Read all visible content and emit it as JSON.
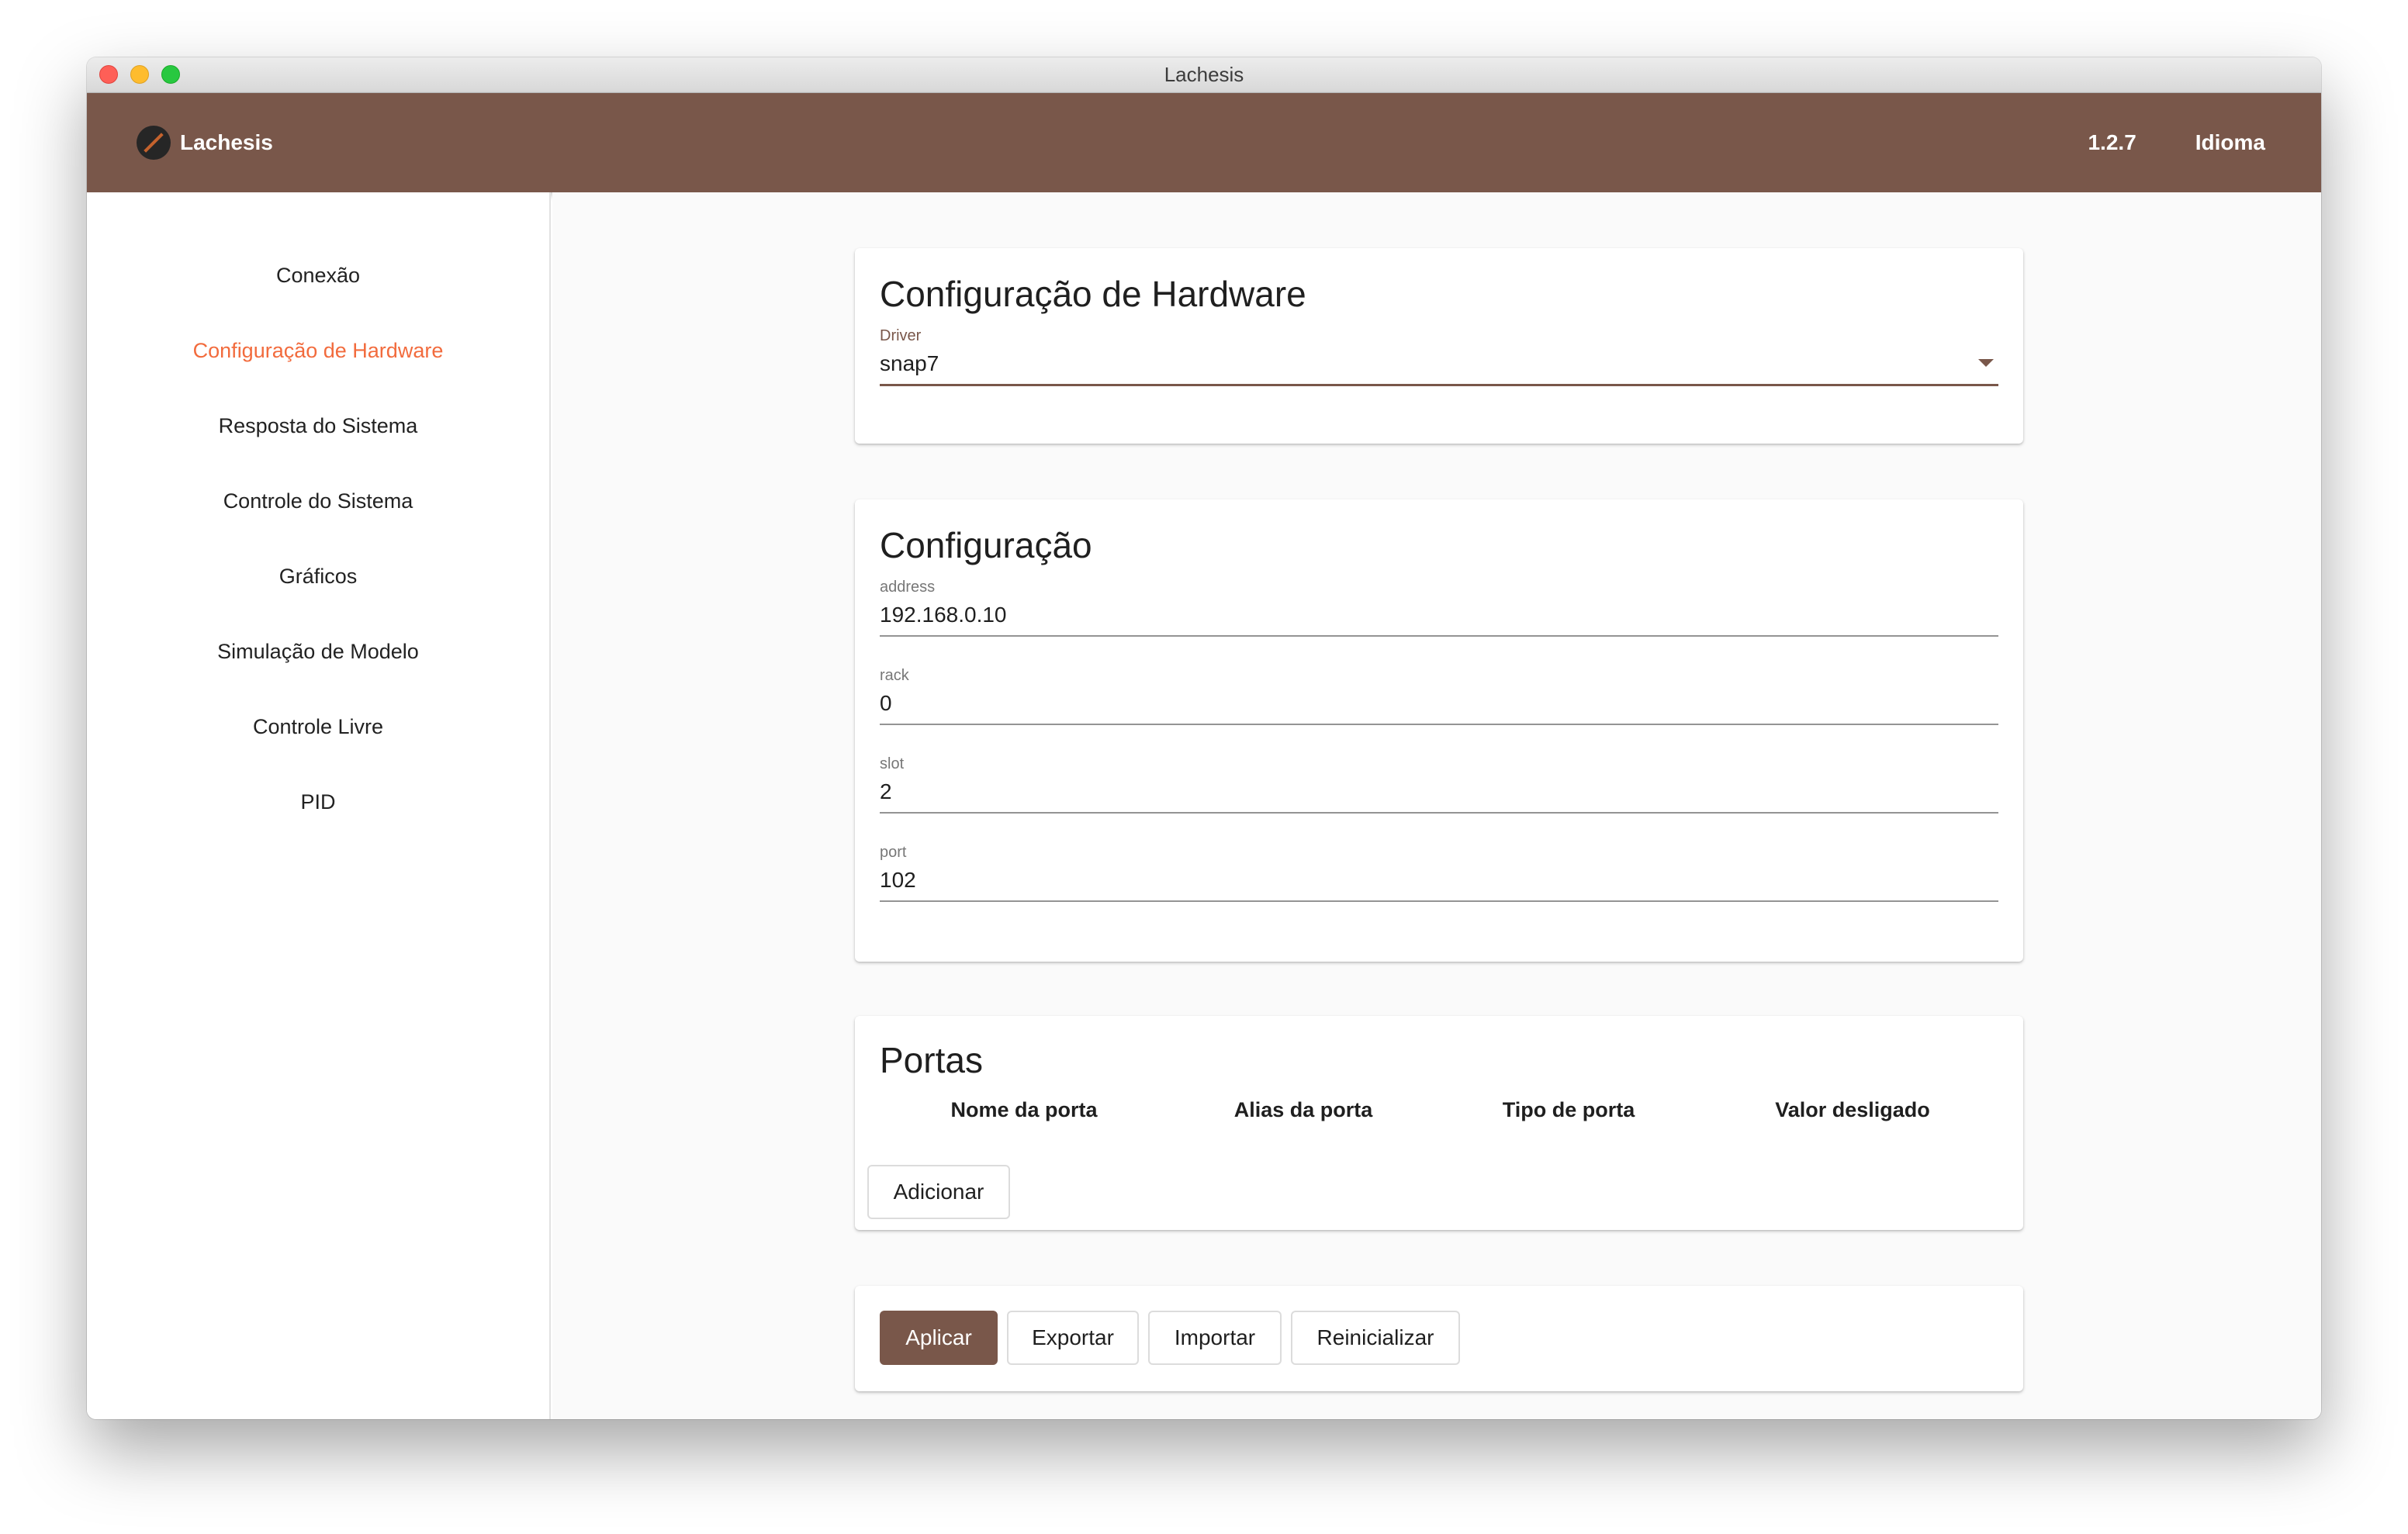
{
  "window": {
    "title": "Lachesis"
  },
  "appbar": {
    "app_name": "Lachesis",
    "version": "1.2.7",
    "language_button": "Idioma"
  },
  "sidebar": {
    "items": [
      {
        "label": "Conexão",
        "active": false
      },
      {
        "label": "Configuração de Hardware",
        "active": true
      },
      {
        "label": "Resposta do Sistema",
        "active": false
      },
      {
        "label": "Controle do Sistema",
        "active": false
      },
      {
        "label": "Gráficos",
        "active": false
      },
      {
        "label": "Simulação de Modelo",
        "active": false
      },
      {
        "label": "Controle Livre",
        "active": false
      },
      {
        "label": "PID",
        "active": false
      }
    ]
  },
  "hardware": {
    "title": "Configuração de Hardware",
    "driver": {
      "label": "Driver",
      "value": "snap7"
    }
  },
  "config": {
    "title": "Configuração",
    "fields": [
      {
        "label": "address",
        "value": "192.168.0.10"
      },
      {
        "label": "rack",
        "value": "0"
      },
      {
        "label": "slot",
        "value": "2"
      },
      {
        "label": "port",
        "value": "102"
      }
    ]
  },
  "ports": {
    "title": "Portas",
    "columns": [
      "Nome da porta",
      "Alias da porta",
      "Tipo de porta",
      "Valor desligado"
    ],
    "add_button": "Adicionar"
  },
  "actions": {
    "apply": "Aplicar",
    "export": "Exportar",
    "import": "Importar",
    "reset": "Reinicializar"
  },
  "colors": {
    "primary": "#79574a",
    "accent": "#f26b3d",
    "background": "#fafafa"
  }
}
